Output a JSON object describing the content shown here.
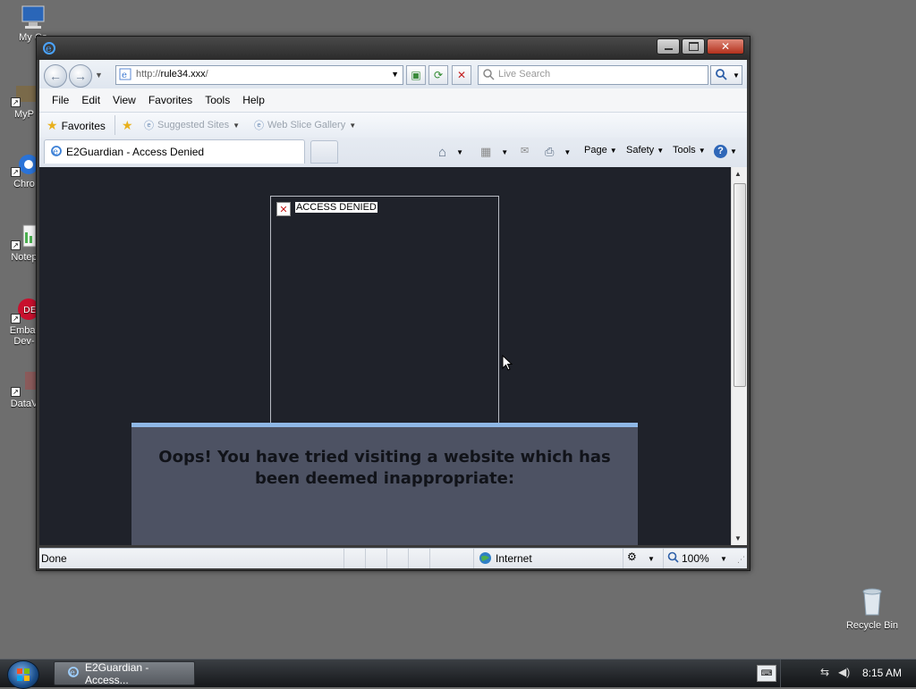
{
  "desktop": {
    "icons": [
      {
        "label": "My Co"
      },
      {
        "label": "MyP"
      },
      {
        "label": "Chro"
      },
      {
        "label": "Notep"
      },
      {
        "label": "Embar"
      },
      {
        "label": "Dev-"
      },
      {
        "label": "DataV"
      }
    ],
    "recycle_bin": "Recycle Bin"
  },
  "browser": {
    "address": {
      "prefix": "http://",
      "host": "rule34.xxx",
      "suffix": "/"
    },
    "search_placeholder": "Live Search",
    "menu": [
      "File",
      "Edit",
      "View",
      "Favorites",
      "Tools",
      "Help"
    ],
    "favorites_bar": {
      "favorites": "Favorites",
      "suggested_sites": "Suggested Sites",
      "web_slice_gallery": "Web Slice Gallery"
    },
    "tab": {
      "title": "E2Guardian - Access Denied"
    },
    "commands": {
      "page": "Page",
      "safety": "Safety",
      "tools": "Tools"
    },
    "status": {
      "text": "Done",
      "zone": "Internet",
      "zoom": "100%"
    }
  },
  "page": {
    "denied_label": "ACCESS DENIED",
    "message": "Oops! You have tried visiting a website which has been deemed inappropriate:"
  },
  "taskbar": {
    "task_label": "E2Guardian - Access...",
    "clock": "8:15 AM"
  },
  "colors": {
    "content_bg": "#1f222a",
    "panel_bg": "#4d5263",
    "panel_accent": "#8fb8e6"
  }
}
